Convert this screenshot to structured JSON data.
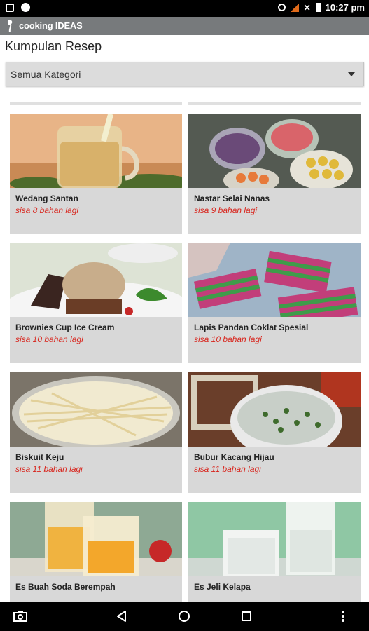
{
  "status_bar": {
    "time": "10:27 pm"
  },
  "app_bar": {
    "title": "cooking IDEAS"
  },
  "page": {
    "title": "Kumpulan Resep"
  },
  "category_select": {
    "selected": "Semua Kategori"
  },
  "recipes": [
    {
      "name": "Wedang Santan",
      "remaining": "sisa 8 bahan lagi"
    },
    {
      "name": "Nastar Selai Nanas",
      "remaining": "sisa 9 bahan lagi"
    },
    {
      "name": "Brownies Cup Ice Cream",
      "remaining": "sisa 10 bahan lagi"
    },
    {
      "name": "Lapis Pandan Coklat Spesial",
      "remaining": "sisa 10 bahan lagi"
    },
    {
      "name": "Biskuit Keju",
      "remaining": "sisa 11 bahan lagi"
    },
    {
      "name": "Bubur Kacang Hijau",
      "remaining": "sisa 11 bahan lagi"
    },
    {
      "name": "Es Buah Soda Berempah",
      "remaining": ""
    },
    {
      "name": "Es Jeli Kelapa",
      "remaining": ""
    }
  ],
  "colors": {
    "accent_red": "#d8261e",
    "card_bg": "#d8d8d8",
    "app_bar": "#777a7c"
  }
}
